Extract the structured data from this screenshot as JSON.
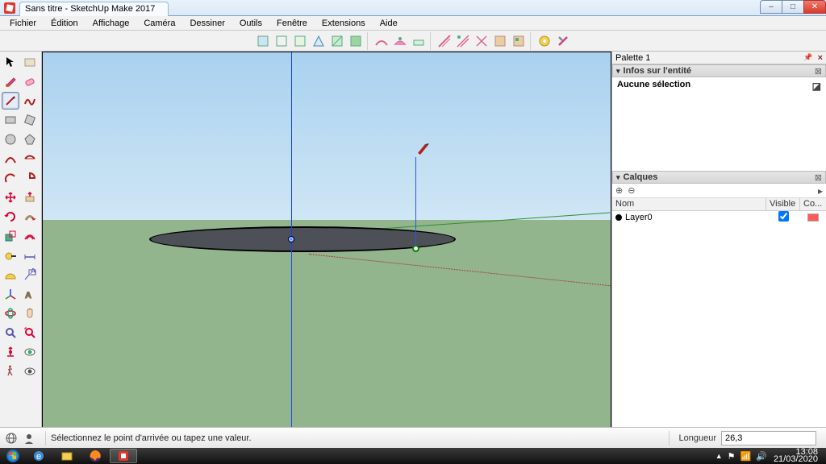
{
  "window": {
    "title": "Sans titre - SketchUp Make 2017",
    "min_tooltip": "Minimize",
    "max_tooltip": "Maximize",
    "close_tooltip": "Close"
  },
  "menu": {
    "items": [
      "Fichier",
      "Édition",
      "Affichage",
      "Caméra",
      "Dessiner",
      "Outils",
      "Fenêtre",
      "Extensions",
      "Aide"
    ]
  },
  "palette": {
    "title": "Palette 1",
    "entity": {
      "header": "Infos sur l'entité",
      "selection": "Aucune sélection"
    },
    "layers": {
      "header": "Calques",
      "col_name": "Nom",
      "col_visible": "Visible",
      "col_color": "Co...",
      "rows": [
        {
          "name": "Layer0",
          "visible": true
        }
      ]
    }
  },
  "status": {
    "hint": "Sélectionnez le point d'arrivée ou tapez une valeur.",
    "measure_label": "Longueur",
    "measure_value": "26,3"
  },
  "taskbar": {
    "time": "13:08",
    "date": "21/03/2020"
  },
  "colors": {
    "accent": "#1a66ff",
    "axis_red": "#b02020",
    "axis_green": "#2f8f2f",
    "axis_blue": "#1040ff",
    "ground": "#93b58e",
    "layer_swatch": "#ff5a5a"
  }
}
